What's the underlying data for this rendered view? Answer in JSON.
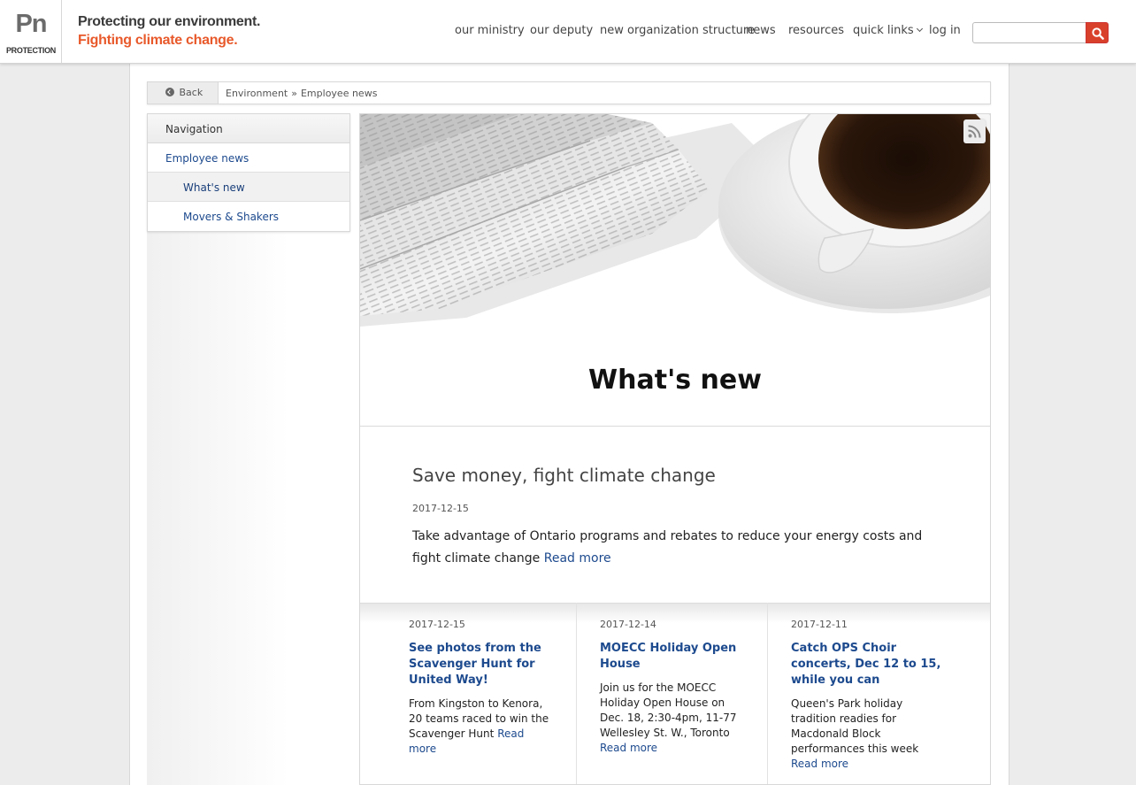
{
  "header": {
    "logo_symbol": "Pn",
    "logo_name": "PROTECTION",
    "tagline_1": "Protecting our environment.",
    "tagline_2": "Fighting climate change.",
    "nav": [
      "our ministry",
      "our deputy",
      "new organization structure",
      "news",
      "resources",
      "quick links",
      "log in"
    ],
    "search_placeholder": "",
    "colors": {
      "tagline_1": "#3a3a3a",
      "tagline_2": "#e8592b",
      "search_button": "#d9402b"
    }
  },
  "breadcrumb": {
    "back_label": "Back",
    "items": [
      "Environment",
      "Employee news"
    ],
    "separator": "»"
  },
  "sidebar": {
    "heading": "Navigation",
    "items": [
      {
        "label": "Employee news"
      },
      {
        "label": "What's new"
      },
      {
        "label": "Movers & Shakers"
      }
    ]
  },
  "main": {
    "title": "What's new",
    "featured": {
      "title": "Save money, fight climate change",
      "date": "2017-12-15",
      "text": "Take advantage of Ontario programs and rebates to reduce your energy costs and fight climate change",
      "read_more": "Read more"
    },
    "cards": [
      {
        "date": "2017-12-15",
        "title": "See photos from the Scavenger Hunt for United Way!",
        "text": "From Kingston to Kenora, 20 teams raced to win the Scavenger Hunt",
        "read_more": "Read more"
      },
      {
        "date": "2017-12-14",
        "title": "MOECC Holiday Open House",
        "text": "Join us for the MOECC Holiday Open House on Dec. 18, 2:30-4pm, 11-77 Wellesley St. W., Toronto",
        "read_more": "Read more"
      },
      {
        "date": "2017-12-11",
        "title": "Catch OPS Choir concerts, Dec 12 to 15, while you can",
        "text": "Queen's Park holiday tradition readies for Macdonald Block performances this week",
        "read_more": "Read more"
      }
    ]
  },
  "icons": [
    "search-icon",
    "back-arrow-icon",
    "chevron-down-icon",
    "rss-icon"
  ]
}
